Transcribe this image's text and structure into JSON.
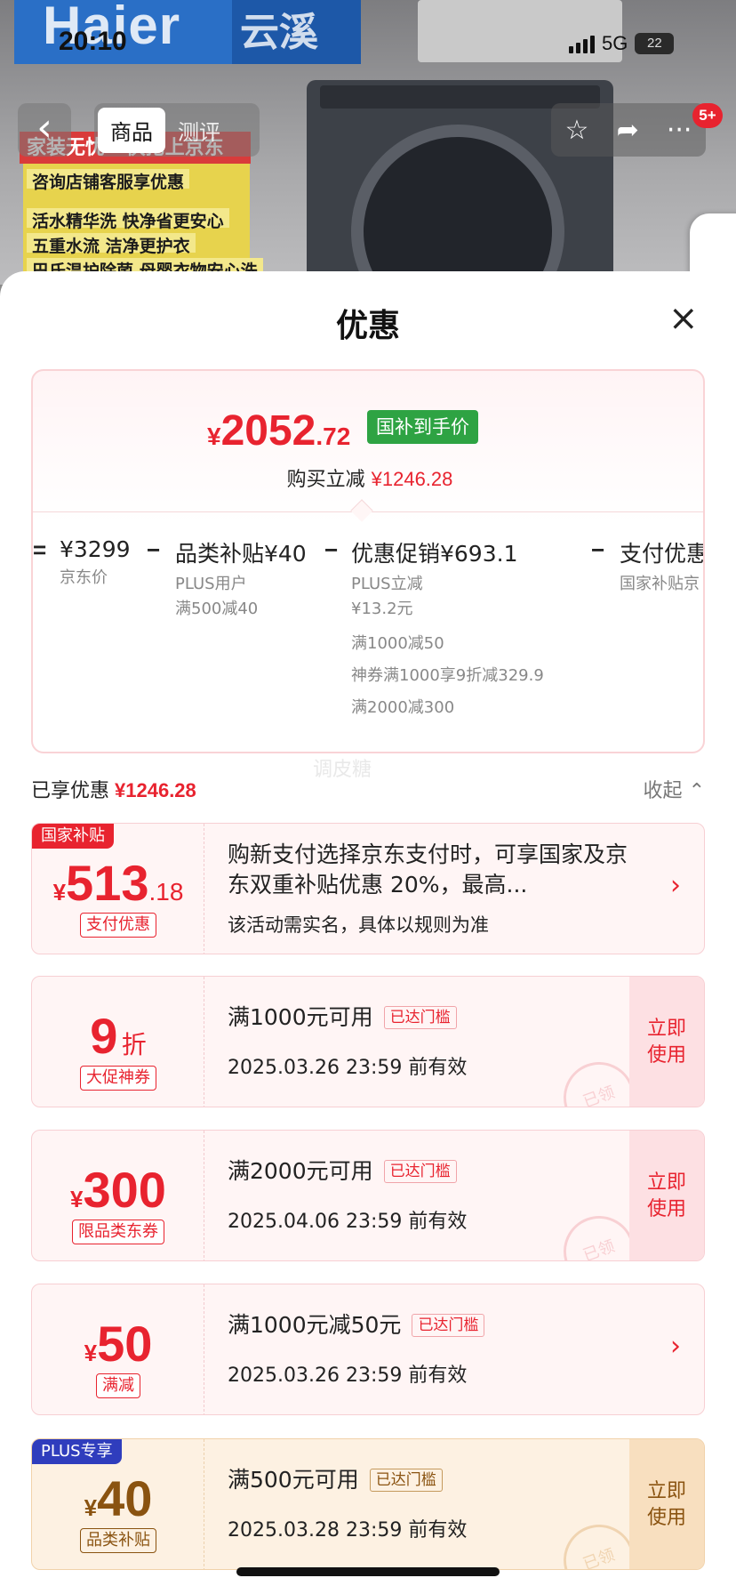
{
  "status_bar": {
    "time": "20:10",
    "network": "5G",
    "battery": "22"
  },
  "background": {
    "brand": "Haier",
    "series": "云溪",
    "poster_top": "家装无忧 · 快抢上京东",
    "poster_lines": [
      "咨询店铺客服享优惠",
      "活水精华洗 快净省更安心",
      "五重水流 洁净更护衣",
      "巴氏温护除菌 母婴衣物安心洗"
    ]
  },
  "nav": {
    "back_icon": "‹",
    "tabs": [
      "商品",
      "测评"
    ],
    "active_tab": 0,
    "badge": "5+"
  },
  "sheet": {
    "title": "优惠",
    "close": "×"
  },
  "summary": {
    "currency": "¥",
    "final_int": "2052",
    "final_dec": ".72",
    "tag": "国补到手价",
    "save_label": "购买立减",
    "save_amount": "¥1246.28",
    "breakdown": [
      {
        "op": "=",
        "main": "¥3299",
        "subs": [
          "京东价"
        ]
      },
      {
        "op": "−",
        "main": "品类补贴¥40",
        "subs": [
          "PLUS用户",
          "满500减40"
        ]
      },
      {
        "op": "−",
        "main": "优惠促销¥693.1",
        "subs": [
          "PLUS立减",
          "¥13.2元",
          "满1000减50",
          "神券满1000享9折减329.9",
          "满2000减300"
        ]
      },
      {
        "op": "−",
        "main": "支付优惠",
        "subs": [
          "国家补贴京"
        ]
      }
    ]
  },
  "watermark": "调皮糖",
  "enjoyed": {
    "label": "已享优惠",
    "amount": "¥1246.28",
    "collapse": "收起"
  },
  "coupons": [
    {
      "corner": "国家补贴",
      "cur": "¥",
      "big": "513",
      "small": ".18",
      "type": "支付优惠",
      "text": "购新支付选择京东支付时，可享国家及京东双重补贴优惠 20%，最高...",
      "sub": "该活动需实名，具体以规则为准",
      "action": "›"
    },
    {
      "cur": "",
      "big": "9",
      "small": "折",
      "type": "大促神券",
      "title": "满1000元可用",
      "threshold": "已达门槛",
      "date": "2025.03.26 23:59 前有效",
      "use": [
        "立即",
        "使用"
      ],
      "stamp": "已领"
    },
    {
      "cur": "¥",
      "big": "300",
      "small": "",
      "type": "限品类东券",
      "title": "满2000元可用",
      "threshold": "已达门槛",
      "date": "2025.04.06 23:59 前有效",
      "use": [
        "立即",
        "使用"
      ],
      "stamp": "已领"
    },
    {
      "cur": "¥",
      "big": "50",
      "small": "",
      "type": "满减",
      "title": "满1000元减50元",
      "threshold": "已达门槛",
      "date": "2025.03.26 23:59 前有效",
      "action": "›"
    },
    {
      "corner": "PLUS专享",
      "cur": "¥",
      "big": "40",
      "small": "",
      "type": "品类补贴",
      "title": "满500元可用",
      "threshold": "已达门槛",
      "date": "2025.03.28 23:59 前有效",
      "use": [
        "立即",
        "使用"
      ],
      "stamp": "已领"
    }
  ]
}
